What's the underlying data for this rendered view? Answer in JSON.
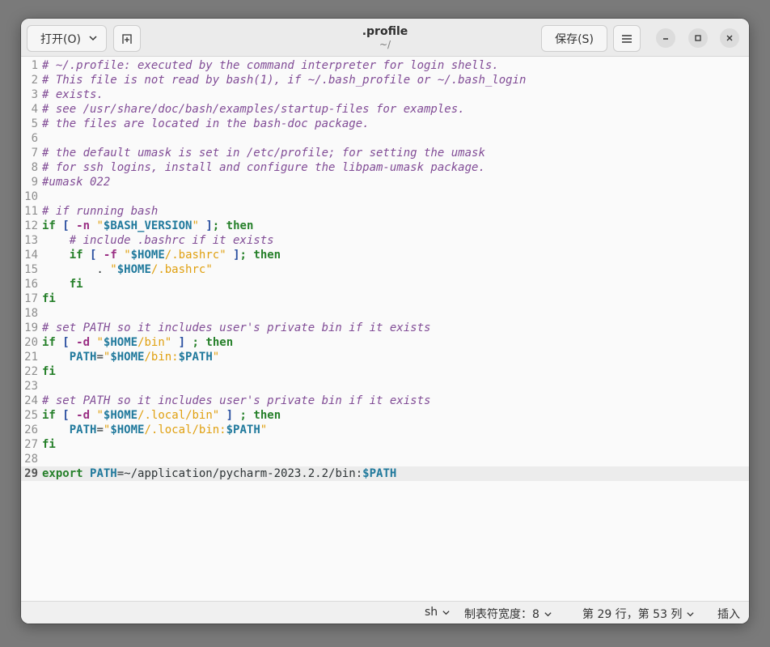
{
  "header": {
    "open_label": "打开(O)",
    "title": ".profile",
    "subtitle": "~/",
    "save_label": "保存(S)"
  },
  "lines": [
    {
      "n": "1",
      "t": [
        [
          "c",
          "# ~/.profile: executed by the command interpreter for login shells."
        ]
      ]
    },
    {
      "n": "2",
      "t": [
        [
          "c",
          "# This file is not read by bash(1), if ~/.bash_profile or ~/.bash_login"
        ]
      ]
    },
    {
      "n": "3",
      "t": [
        [
          "c",
          "# exists."
        ]
      ]
    },
    {
      "n": "4",
      "t": [
        [
          "c",
          "# see /usr/share/doc/bash/examples/startup-files for examples."
        ]
      ]
    },
    {
      "n": "5",
      "t": [
        [
          "c",
          "# the files are located in the bash-doc package."
        ]
      ]
    },
    {
      "n": "6",
      "t": []
    },
    {
      "n": "7",
      "t": [
        [
          "c",
          "# the default umask is set in /etc/profile; for setting the umask"
        ]
      ]
    },
    {
      "n": "8",
      "t": [
        [
          "c",
          "# for ssh logins, install and configure the libpam-umask package."
        ]
      ]
    },
    {
      "n": "9",
      "t": [
        [
          "c",
          "#umask 022"
        ]
      ]
    },
    {
      "n": "10",
      "t": []
    },
    {
      "n": "11",
      "t": [
        [
          "c",
          "# if running bash"
        ]
      ]
    },
    {
      "n": "12",
      "t": [
        [
          "k",
          "if"
        ],
        [
          "n",
          " "
        ],
        [
          "p",
          "["
        ],
        [
          "n",
          " "
        ],
        [
          "o",
          "-n"
        ],
        [
          "n",
          " "
        ],
        [
          "str",
          "\""
        ],
        [
          "v",
          "$BASH_VERSION"
        ],
        [
          "str",
          "\""
        ],
        [
          "n",
          " "
        ],
        [
          "p",
          "]"
        ],
        [
          "k",
          ";"
        ],
        [
          "n",
          " "
        ],
        [
          "k",
          "then"
        ]
      ]
    },
    {
      "n": "13",
      "t": [
        [
          "n",
          "    "
        ],
        [
          "c",
          "# include .bashrc if it exists"
        ]
      ]
    },
    {
      "n": "14",
      "t": [
        [
          "n",
          "    "
        ],
        [
          "k",
          "if"
        ],
        [
          "n",
          " "
        ],
        [
          "p",
          "["
        ],
        [
          "n",
          " "
        ],
        [
          "o",
          "-f"
        ],
        [
          "n",
          " "
        ],
        [
          "str",
          "\""
        ],
        [
          "v",
          "$HOME"
        ],
        [
          "str",
          "/.bashrc\""
        ],
        [
          "n",
          " "
        ],
        [
          "p",
          "]"
        ],
        [
          "k",
          ";"
        ],
        [
          "n",
          " "
        ],
        [
          "k",
          "then"
        ]
      ]
    },
    {
      "n": "15",
      "t": [
        [
          "n",
          "        . "
        ],
        [
          "str",
          "\""
        ],
        [
          "v",
          "$HOME"
        ],
        [
          "str",
          "/.bashrc\""
        ]
      ]
    },
    {
      "n": "16",
      "t": [
        [
          "n",
          "    "
        ],
        [
          "k",
          "fi"
        ]
      ]
    },
    {
      "n": "17",
      "t": [
        [
          "k",
          "fi"
        ]
      ]
    },
    {
      "n": "18",
      "t": []
    },
    {
      "n": "19",
      "t": [
        [
          "c",
          "# set PATH so it includes user's private bin if it exists"
        ]
      ]
    },
    {
      "n": "20",
      "t": [
        [
          "k",
          "if"
        ],
        [
          "n",
          " "
        ],
        [
          "p",
          "["
        ],
        [
          "n",
          " "
        ],
        [
          "o",
          "-d"
        ],
        [
          "n",
          " "
        ],
        [
          "str",
          "\""
        ],
        [
          "v",
          "$HOME"
        ],
        [
          "str",
          "/bin\""
        ],
        [
          "n",
          " "
        ],
        [
          "p",
          "]"
        ],
        [
          "n",
          " "
        ],
        [
          "k",
          ";"
        ],
        [
          "n",
          " "
        ],
        [
          "k",
          "then"
        ]
      ]
    },
    {
      "n": "21",
      "t": [
        [
          "n",
          "    "
        ],
        [
          "v",
          "PATH"
        ],
        [
          "n",
          "="
        ],
        [
          "str",
          "\""
        ],
        [
          "v",
          "$HOME"
        ],
        [
          "str",
          "/bin:"
        ],
        [
          "v",
          "$PATH"
        ],
        [
          "str",
          "\""
        ]
      ]
    },
    {
      "n": "22",
      "t": [
        [
          "k",
          "fi"
        ]
      ]
    },
    {
      "n": "23",
      "t": []
    },
    {
      "n": "24",
      "t": [
        [
          "c",
          "# set PATH so it includes user's private bin if it exists"
        ]
      ]
    },
    {
      "n": "25",
      "t": [
        [
          "k",
          "if"
        ],
        [
          "n",
          " "
        ],
        [
          "p",
          "["
        ],
        [
          "n",
          " "
        ],
        [
          "o",
          "-d"
        ],
        [
          "n",
          " "
        ],
        [
          "str",
          "\""
        ],
        [
          "v",
          "$HOME"
        ],
        [
          "str",
          "/.local/bin\""
        ],
        [
          "n",
          " "
        ],
        [
          "p",
          "]"
        ],
        [
          "n",
          " "
        ],
        [
          "k",
          ";"
        ],
        [
          "n",
          " "
        ],
        [
          "k",
          "then"
        ]
      ]
    },
    {
      "n": "26",
      "t": [
        [
          "n",
          "    "
        ],
        [
          "v",
          "PATH"
        ],
        [
          "n",
          "="
        ],
        [
          "str",
          "\""
        ],
        [
          "v",
          "$HOME"
        ],
        [
          "str",
          "/.local/bin:"
        ],
        [
          "v",
          "$PATH"
        ],
        [
          "str",
          "\""
        ]
      ]
    },
    {
      "n": "27",
      "t": [
        [
          "k",
          "fi"
        ]
      ]
    },
    {
      "n": "28",
      "t": []
    },
    {
      "n": "29",
      "t": [
        [
          "k",
          "export"
        ],
        [
          "n",
          " "
        ],
        [
          "v",
          "PATH"
        ],
        [
          "n",
          "=~/application/pycharm-2023.2.2/bin:"
        ],
        [
          "v",
          "$PATH"
        ]
      ]
    }
  ],
  "current_line": "29",
  "status": {
    "language": "sh",
    "tab_width": "制表符宽度：8",
    "position": "第 29 行，第 53 列",
    "mode": "插入"
  }
}
